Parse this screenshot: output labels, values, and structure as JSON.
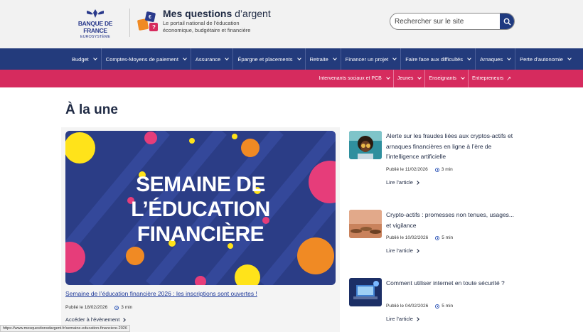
{
  "header": {
    "bdf_logo_name": "BANQUE DE FRANCE",
    "bdf_logo_sub": "EUROSYSTÈME",
    "site_title_strong": "Mes questions",
    "site_title_light": "d’argent",
    "site_tagline": "Le portail national de l’éducation économique, budgétaire et financière",
    "search_placeholder": "Rechercher sur le site"
  },
  "nav": {
    "items": [
      {
        "label": "Budget"
      },
      {
        "label": "Comptes-Moyens de paiement"
      },
      {
        "label": "Assurance"
      },
      {
        "label": "Épargne et placements"
      },
      {
        "label": "Retraite"
      },
      {
        "label": "Financer un projet"
      },
      {
        "label": "Faire face aux difficultés"
      },
      {
        "label": "Arnaques"
      },
      {
        "label": "Perte d’autonomie"
      }
    ]
  },
  "subnav": {
    "items": [
      {
        "label": "Intervenants sociaux et PCB"
      },
      {
        "label": "Jeunes"
      },
      {
        "label": "Enseignants"
      },
      {
        "label": "Entrepreneurs"
      }
    ]
  },
  "main": {
    "heading": "À la une",
    "feature": {
      "image_text": [
        "SEMAINE DE",
        "L’ÉDUCATION",
        "FINANCIÈRE"
      ],
      "link": "Semaine de l’éducation financière 2026 : les inscriptions sont ouvertes !",
      "date": "Publié le 18/02/2026",
      "read_time": "3 min",
      "cta": "Accéder à l’évènement"
    },
    "articles": [
      {
        "title": "Alerte sur les fraudes liées aux cryptos-actifs et arnaques financières en ligne à l’ère de l’intelligence artificielle",
        "date": "Publié le 11/02/2026",
        "read_time": "3 min",
        "cta": "Lire l’article"
      },
      {
        "title": "Crypto-actifs : promesses non tenues, usages... et vigilance",
        "date": "Publié le 10/02/2026",
        "read_time": "5 min",
        "cta": "Lire l’article"
      },
      {
        "title": "Comment utiliser internet en toute sécurité ?",
        "date": "Publié le 04/02/2026",
        "read_time": "5 min",
        "cta": "Lire l’article"
      }
    ]
  },
  "status_url": "https://www.mesquestionsdargent.fr/semaine-education-financiere-2026",
  "colors": {
    "nav": "#233b7c",
    "subnav": "#d62b5e",
    "feature_bg": "#2b3d86"
  }
}
